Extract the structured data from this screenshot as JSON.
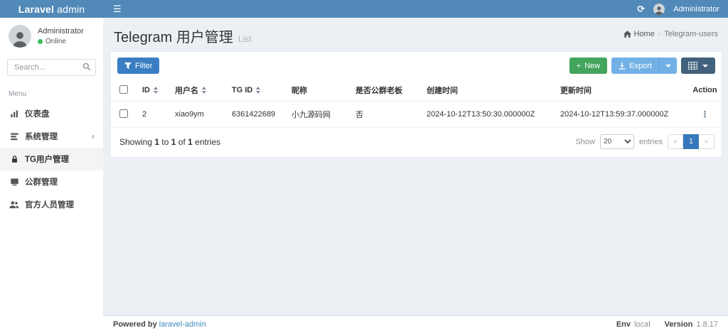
{
  "icons": {
    "hamburger": "☰",
    "refresh": "⟳",
    "dots": "⋮",
    "chevron_collapsed": "‹",
    "breadcrumb_sep": "›"
  },
  "navbar": {
    "logo_bold": "Laravel",
    "logo_light": "admin",
    "user": "Administrator"
  },
  "sidebar": {
    "user_name": "Administrator",
    "user_status": "Online",
    "search_placeholder": "Search...",
    "menu_header": "Menu",
    "items": [
      {
        "label": "仪表盘"
      },
      {
        "label": "系统管理"
      },
      {
        "label": "TG用户管理"
      },
      {
        "label": "公群管理"
      },
      {
        "label": "官方人员管理"
      }
    ]
  },
  "content": {
    "title": "Telegram 用户管理",
    "subtitle": "List",
    "breadcrumb": {
      "home": "Home",
      "current": "Telegram-users"
    }
  },
  "toolbar": {
    "filter_label": "Filter",
    "new_plus": "+",
    "new_label": "New",
    "export_label": "Export"
  },
  "table": {
    "columns": [
      {
        "label": "ID"
      },
      {
        "label": "用户名"
      },
      {
        "label": "TG ID"
      },
      {
        "label": "昵称"
      },
      {
        "label": "是否公群老板"
      },
      {
        "label": "创建时间"
      },
      {
        "label": "更新时间"
      },
      {
        "label": "Action"
      }
    ],
    "rows": [
      {
        "id": "2",
        "username": "xiao9ym",
        "tg_id": "6361422689",
        "nickname": "小九源码网",
        "is_group_boss": "否",
        "created_at": "2024-10-12T13:50:30.000000Z",
        "updated_at": "2024-10-12T13:59:37.000000Z"
      }
    ]
  },
  "table_footer": {
    "showing": {
      "s1": "Showing ",
      "n1": "1",
      "s2": " to ",
      "n2": "1",
      "s3": " of ",
      "n3": "1",
      "s4": " entries"
    },
    "show_label": "Show",
    "per_page": "20",
    "entries_label": "entries",
    "pagination": {
      "prev": "«",
      "page1": "1",
      "next": "»"
    }
  },
  "footer": {
    "powered_by": "Powered by ",
    "powered_link": "laravel-admin",
    "env_label": "Env",
    "env_value": "local",
    "version_label": "Version",
    "version_value": "1.8.17"
  }
}
